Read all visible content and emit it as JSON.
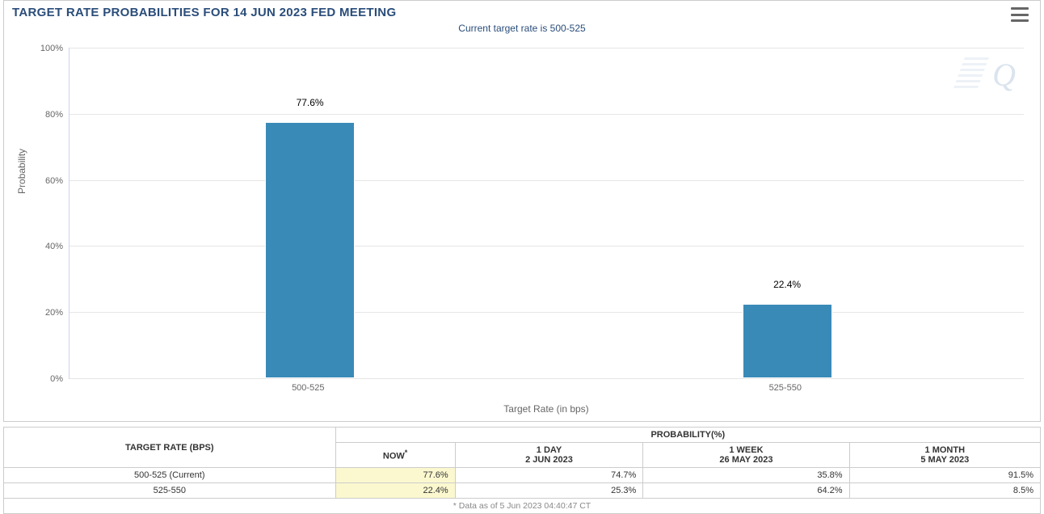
{
  "chart_data": {
    "type": "bar",
    "title": "TARGET RATE PROBABILITIES FOR 14 JUN 2023 FED MEETING",
    "subtitle": "Current target rate is 500-525",
    "xlabel": "Target Rate (in bps)",
    "ylabel": "Probability",
    "categories": [
      "500-525",
      "525-550"
    ],
    "values": [
      77.6,
      22.4
    ],
    "value_labels": [
      "77.6%",
      "22.4%"
    ],
    "ylim": [
      0,
      100
    ],
    "yticks": [
      0,
      20,
      40,
      60,
      80,
      100
    ],
    "ytick_labels": [
      "0%",
      "20%",
      "40%",
      "60%",
      "80%",
      "100%"
    ]
  },
  "table": {
    "col1_header": "TARGET RATE (BPS)",
    "col2_header": "PROBABILITY(%)",
    "periods": [
      {
        "label": "NOW",
        "asterisk": "*",
        "date": ""
      },
      {
        "label": "1 DAY",
        "date": "2 JUN 2023"
      },
      {
        "label": "1 WEEK",
        "date": "26 MAY 2023"
      },
      {
        "label": "1 MONTH",
        "date": "5 MAY 2023"
      }
    ],
    "rows": [
      {
        "rate": "500-525 (Current)",
        "vals": [
          "77.6%",
          "74.7%",
          "35.8%",
          "91.5%"
        ]
      },
      {
        "rate": "525-550",
        "vals": [
          "22.4%",
          "25.3%",
          "64.2%",
          "8.5%"
        ]
      }
    ],
    "footnote": "* Data as of 5 Jun 2023 04:40:47 CT"
  },
  "watermark": "Q"
}
